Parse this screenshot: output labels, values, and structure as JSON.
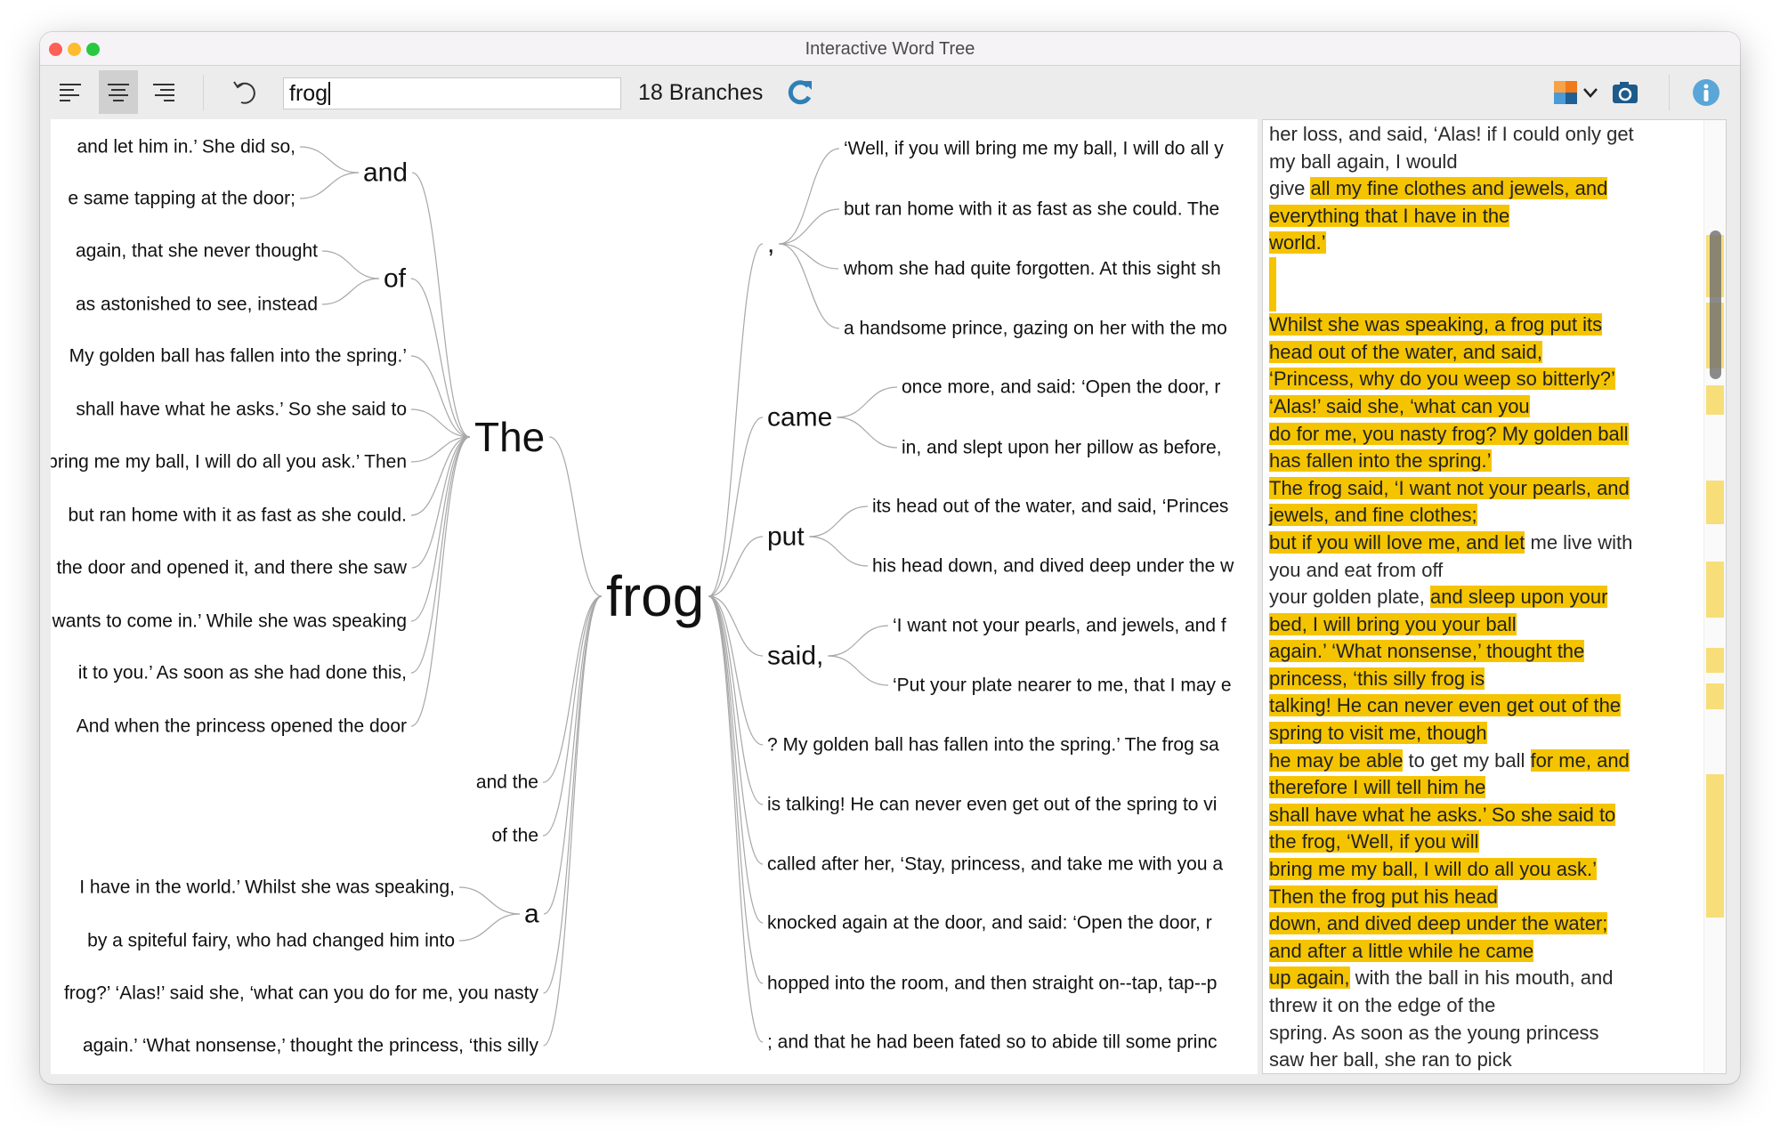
{
  "window": {
    "title": "Interactive Word Tree"
  },
  "toolbar": {
    "align_left": "align-left-icon",
    "align_center": "align-center-icon",
    "align_right": "align-right-icon",
    "selected_alignment": "center",
    "search_value": "frog",
    "branches_label": "18 Branches",
    "accent": "#2f7fb7"
  },
  "tree": {
    "root": "frog",
    "left": {
      "the": {
        "word": "The",
        "and": {
          "word": "and",
          "leaves": [
            "and let him in.’ She did so,",
            "e same tapping at the door;"
          ]
        },
        "of": {
          "word": "of",
          "leaves": [
            "again, that she never thought",
            "as astonished to see, instead"
          ]
        },
        "leaves": [
          "My golden ball has fallen into the spring.’",
          "shall have what he asks.’ So she said to",
          "bring me my ball, I will do all you ask.’ Then",
          "but ran home with it as fast as she could.",
          "the door and opened it, and there she saw",
          "wants to come in.’ While she was speaking",
          "it to you.’ As soon as she had done this,",
          "And when the princess opened the door"
        ]
      },
      "and_the": "and the",
      "of_the": "of the",
      "a": {
        "word": "a",
        "leaves": [
          "I have in the world.’ Whilst she was speaking,",
          "by a spiteful fairy, who had changed him into"
        ]
      },
      "leaves": [
        "frog?’ ‘Alas!’ said she, ‘what can you do for me, you nasty",
        "again.’ ‘What nonsense,’ thought the princess, ‘this silly"
      ]
    },
    "right": {
      "comma": {
        "word": ",",
        "leaves": [
          "‘Well, if you will bring me my ball, I will do all y",
          "but ran home with it as fast as she could. The",
          "whom she had quite forgotten. At this sight sh",
          "a handsome prince, gazing on her with the mo"
        ]
      },
      "came": {
        "word": "came",
        "leaves": [
          "once more, and said:  ‘Open the door, r",
          "in, and slept upon her pillow as before,"
        ]
      },
      "put": {
        "word": "put",
        "leaves": [
          "its head out of the water, and said, ‘Princes",
          "his head down, and dived deep under the w"
        ]
      },
      "said": {
        "word": "said,",
        "leaves": [
          "‘I want not your pearls, and jewels, and f",
          "‘Put your plate nearer to me, that I may e"
        ]
      },
      "leaves": [
        "? My golden ball has fallen into the spring.’ The frog sa",
        "is talking! He can never even get out of the spring to vi",
        "called after her, ‘Stay, princess, and take me with you a",
        "knocked again at the door, and said:  ‘Open the door, r",
        "hopped into the room, and then straight on--tap, tap--p",
        "; and that he had been fated so to abide till some princ"
      ]
    }
  },
  "panel": {
    "highlight_color": "#f5c400",
    "lines": [
      [
        [
          "her loss, and said, ‘Alas! if I could only get",
          0
        ]
      ],
      [
        [
          "my ball again, I would",
          0
        ]
      ],
      [
        [
          "give ",
          0
        ],
        [
          "all my fine clothes and jewels, and",
          1
        ]
      ],
      [
        [
          "everything that I have in the",
          1
        ]
      ],
      [
        [
          "world.’",
          1
        ]
      ],
      [],
      [],
      [
        [
          "Whilst she was speaking, a frog put its",
          1
        ]
      ],
      [
        [
          "head out of the water, and said,",
          1
        ]
      ],
      [
        [
          "‘Princess, why do you weep so bitterly?’",
          1
        ]
      ],
      [
        [
          "‘Alas!’ said she, ‘what can you",
          1
        ]
      ],
      [
        [
          "do for me, you nasty frog? My golden ball",
          1
        ]
      ],
      [
        [
          "has fallen into the spring.’",
          1
        ]
      ],
      [
        [
          "The frog said, ‘I want not your pearls, and",
          1
        ]
      ],
      [
        [
          "jewels, and fine clothes;",
          1
        ]
      ],
      [
        [
          "but if you will love me, and let",
          1
        ],
        [
          " me live with",
          0
        ]
      ],
      [
        [
          "you and eat from off",
          0
        ]
      ],
      [
        [
          "your golden plate, ",
          0
        ],
        [
          "and sleep upon your",
          1
        ]
      ],
      [
        [
          "bed, I will bring you your ball",
          1
        ]
      ],
      [
        [
          "again.’ ‘What nonsense,’ thought the",
          1
        ]
      ],
      [
        [
          "princess, ‘this silly frog is",
          1
        ]
      ],
      [
        [
          "talking! He can never even get out of the",
          1
        ]
      ],
      [
        [
          "spring to visit me, though",
          1
        ]
      ],
      [
        [
          "he may be able",
          1
        ],
        [
          " to get my ball ",
          0
        ],
        [
          "for me, and",
          1
        ]
      ],
      [
        [
          "therefore I will tell him he",
          1
        ]
      ],
      [
        [
          "shall have what he asks.’ So she said to",
          1
        ]
      ],
      [
        [
          "the frog, ‘Well, if you will",
          1
        ]
      ],
      [
        [
          "bring me my ball, I will do all you ask.’",
          1
        ]
      ],
      [
        [
          "Then the frog put his head",
          1
        ]
      ],
      [
        [
          "down, and dived deep under the water;",
          1
        ]
      ],
      [
        [
          "and after a little while he came",
          1
        ]
      ],
      [
        [
          "up again,",
          1
        ],
        [
          " with the ball in his mouth, and",
          0
        ]
      ],
      [
        [
          "threw it on the edge of the",
          0
        ]
      ],
      [
        [
          "spring. As soon as the young princess",
          0
        ]
      ],
      [
        [
          "saw her ball, she ran to pick",
          0
        ]
      ]
    ]
  }
}
